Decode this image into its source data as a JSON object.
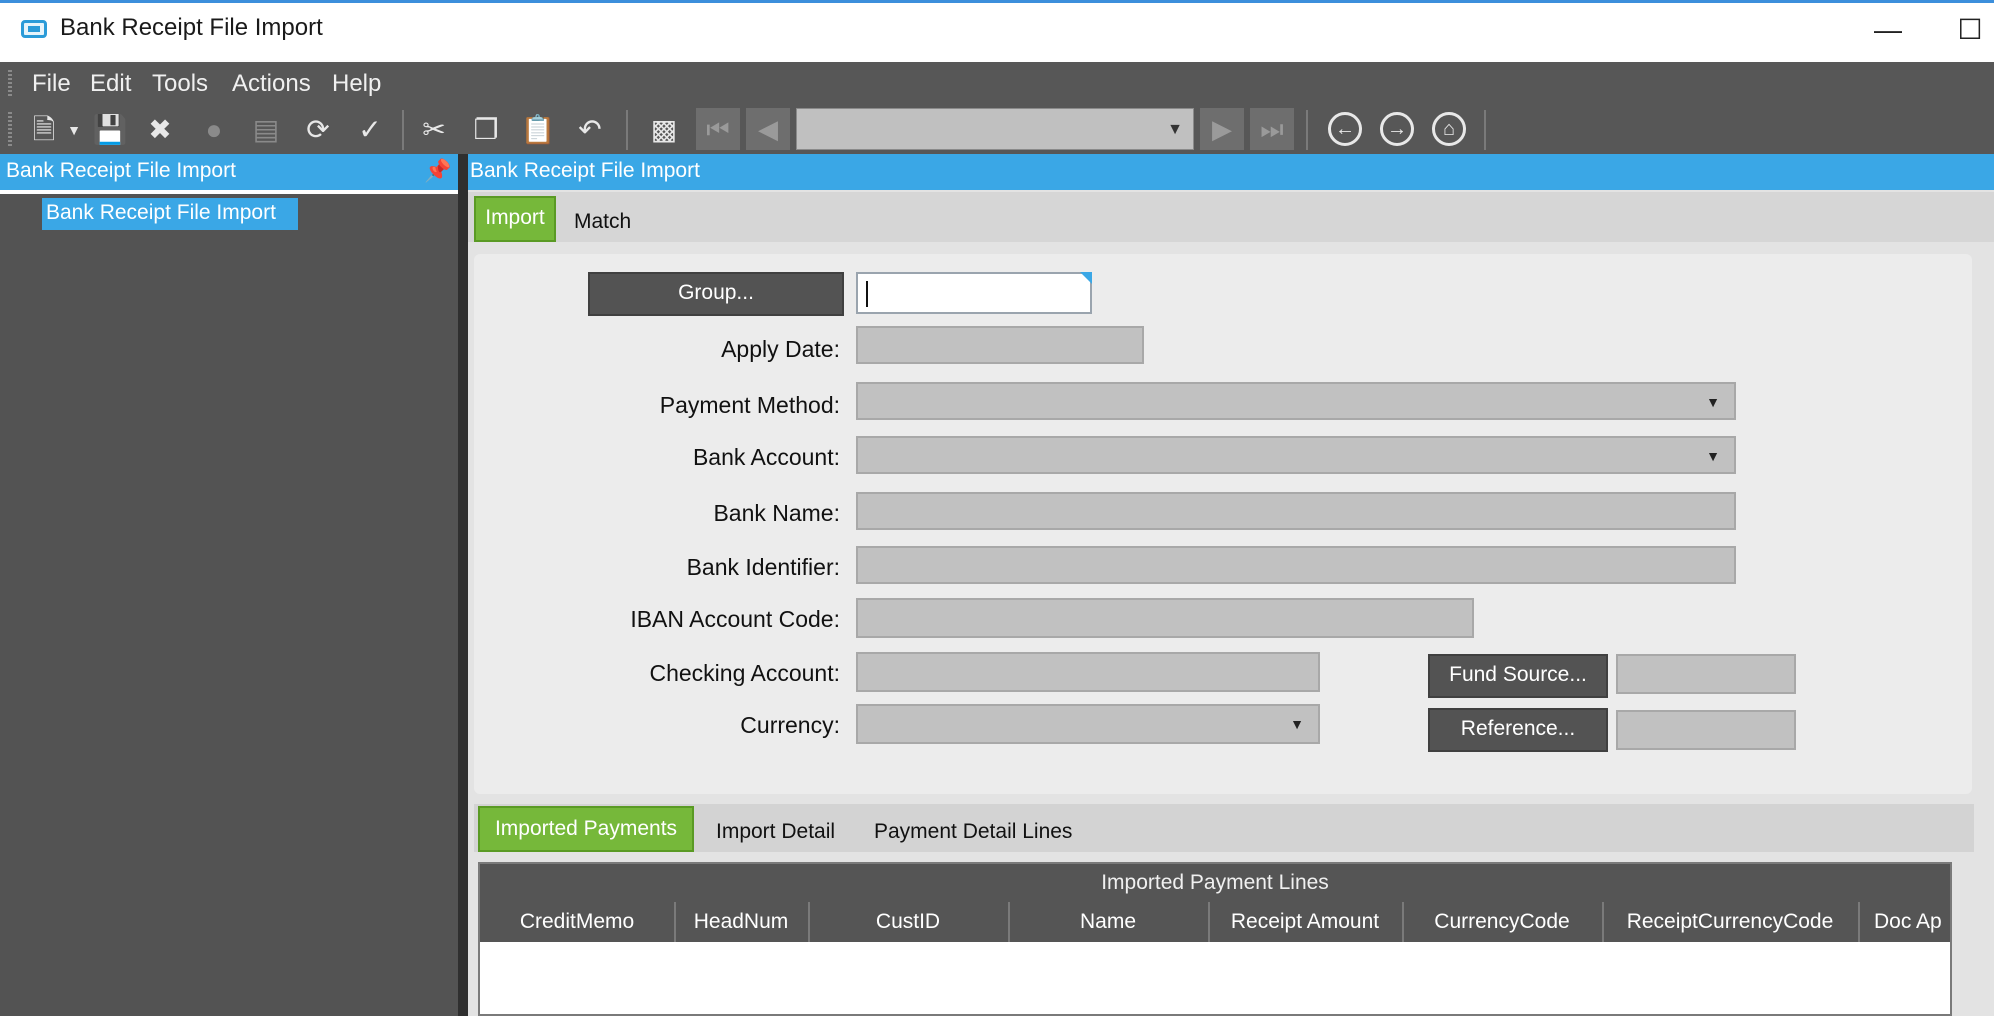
{
  "window": {
    "title": "Bank Receipt File Import",
    "minimize_icon": "minimize-icon",
    "maximize_icon": "maximize-icon"
  },
  "menu": [
    "File",
    "Edit",
    "Tools",
    "Actions",
    "Help"
  ],
  "left_panel": {
    "header": "Bank Receipt File Import",
    "tree_item": "Bank Receipt File Import"
  },
  "main": {
    "header": "Bank Receipt File Import"
  },
  "tabs": [
    {
      "label": "Import",
      "active": true
    },
    {
      "label": "Match",
      "active": false
    }
  ],
  "form": {
    "group_button": "Group...",
    "group_value": "",
    "apply_date_label": "Apply Date:",
    "payment_method_label": "Payment Method:",
    "bank_account_label": "Bank Account:",
    "bank_name_label": "Bank Name:",
    "bank_identifier_label": "Bank Identifier:",
    "iban_label": "IBAN Account Code:",
    "checking_account_label": "Checking Account:",
    "currency_label": "Currency:",
    "fund_source_button": "Fund Source...",
    "reference_button": "Reference..."
  },
  "subtabs": [
    {
      "label": "Imported Payments",
      "active": true
    },
    {
      "label": "Import Detail",
      "active": false
    },
    {
      "label": "Payment Detail Lines",
      "active": false
    }
  ],
  "grid": {
    "title": "Imported Payment Lines",
    "columns": [
      "CreditMemo",
      "HeadNum",
      "CustID",
      "Name",
      "Receipt Amount",
      "CurrencyCode",
      "ReceiptCurrencyCode",
      "Doc Ap"
    ]
  },
  "colors": {
    "accent": "#3aa7e6",
    "active_tab": "#76b83a",
    "dark_chrome": "#575757"
  }
}
